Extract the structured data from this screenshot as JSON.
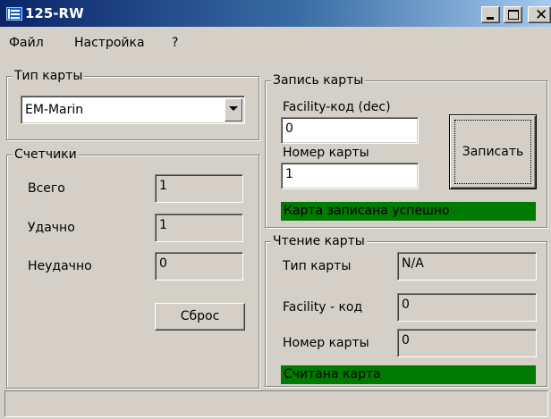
{
  "window": {
    "title": "125-RW"
  },
  "menu": {
    "items": [
      "Файл",
      "Настройка",
      "?"
    ]
  },
  "card_type": {
    "legend": "Тип карты",
    "selected": "EM-Marin"
  },
  "counters": {
    "legend": "Счетчики",
    "total_label": "Всего",
    "total_value": "1",
    "success_label": "Удачно",
    "success_value": "1",
    "fail_label": "Неудачно",
    "fail_value": "0",
    "reset_label": "Сброс"
  },
  "write": {
    "legend": "Запись карты",
    "facility_label": "Facility-код (dec)",
    "facility_value": "0",
    "number_label": "Номер карты",
    "number_value": "1",
    "write_button": "Записать",
    "status": "Карта записана успешно"
  },
  "read": {
    "legend": "Чтение карты",
    "type_label": "Тип карты",
    "type_value": "N/A",
    "facility_label": "Facility - код",
    "facility_value": "0",
    "number_label": "Номер карты",
    "number_value": "0",
    "status": "Считана карта"
  },
  "colors": {
    "status_green": "#007a00",
    "titlebar_dark": "#0a246a",
    "titlebar_light": "#a6caf0"
  }
}
